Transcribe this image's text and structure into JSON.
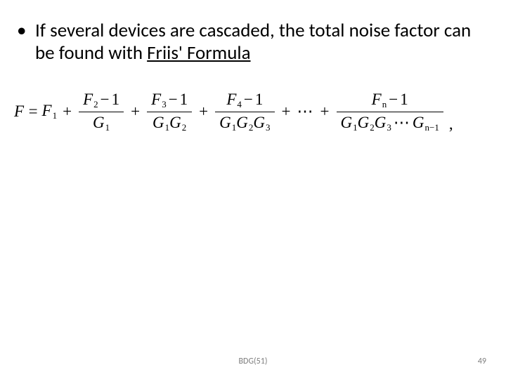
{
  "bullet": {
    "marker": "•",
    "text_before_link": "If several devices are cascaded, the total noise factor can be found with ",
    "link_text": "Friis' Formula"
  },
  "formula": {
    "lhs": "F",
    "eq": "=",
    "first_term": {
      "sym": "F",
      "sub": "1"
    },
    "fracs": [
      {
        "num_sym": "F",
        "num_sub": "2",
        "num_tail": "− 1",
        "den": [
          {
            "sym": "G",
            "sub": "1"
          }
        ]
      },
      {
        "num_sym": "F",
        "num_sub": "3",
        "num_tail": "− 1",
        "den": [
          {
            "sym": "G",
            "sub": "1"
          },
          {
            "sym": "G",
            "sub": "2"
          }
        ]
      },
      {
        "num_sym": "F",
        "num_sub": "4",
        "num_tail": "− 1",
        "den": [
          {
            "sym": "G",
            "sub": "1"
          },
          {
            "sym": "G",
            "sub": "2"
          },
          {
            "sym": "G",
            "sub": "3"
          }
        ]
      }
    ],
    "ellipsis": "⋯",
    "last_frac": {
      "num_sym": "F",
      "num_sub": "n",
      "num_tail": "− 1",
      "den_pre": [
        {
          "sym": "G",
          "sub": "1"
        },
        {
          "sym": "G",
          "sub": "2"
        },
        {
          "sym": "G",
          "sub": "3"
        }
      ],
      "den_ellipsis": "⋯",
      "den_last": {
        "sym": "G",
        "sub": "n−1"
      }
    },
    "trailing": ","
  },
  "footer": {
    "center": "BDG(51)",
    "page": "49"
  }
}
